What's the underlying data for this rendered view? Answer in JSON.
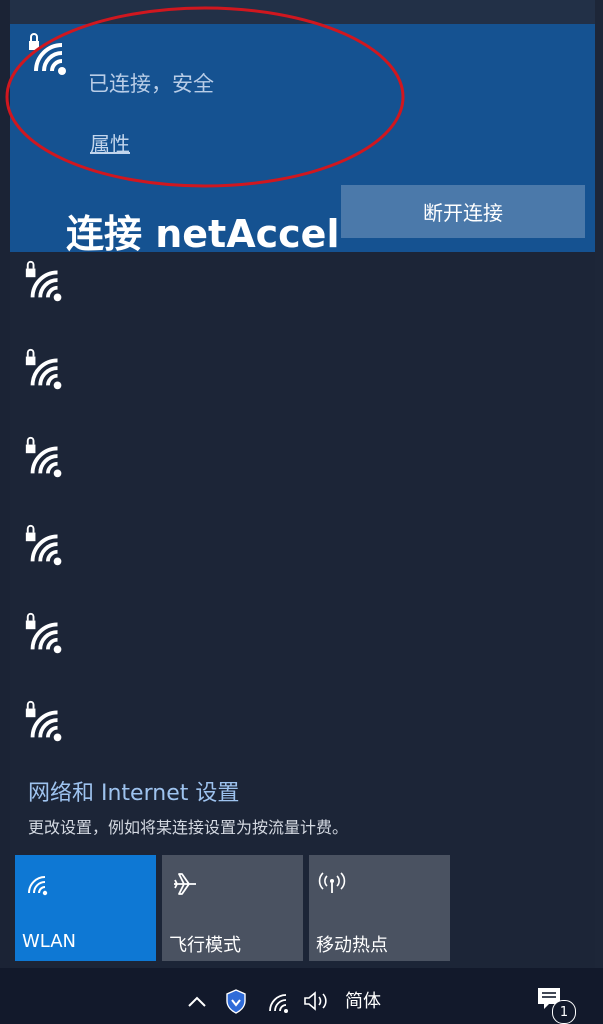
{
  "connected_network": {
    "status": "已连接，安全",
    "properties_link": "属性",
    "disconnect_button": "断开连接"
  },
  "overlay_title": "连接 netAccel",
  "network_list": {
    "items": [
      {
        "icon": "wifi-secured-icon"
      },
      {
        "icon": "wifi-secured-icon"
      },
      {
        "icon": "wifi-secured-icon"
      },
      {
        "icon": "wifi-secured-icon"
      },
      {
        "icon": "wifi-secured-icon"
      },
      {
        "icon": "wifi-secured-icon"
      }
    ]
  },
  "settings": {
    "title": "网络和 Internet 设置",
    "subtitle": "更改设置，例如将某连接设置为按流量计费。"
  },
  "quick_actions": [
    {
      "label": "WLAN",
      "icon": "wifi-icon",
      "active": true
    },
    {
      "label": "飞行模式",
      "icon": "airplane-icon",
      "active": false
    },
    {
      "label": "移动热点",
      "icon": "hotspot-icon",
      "active": false
    }
  ],
  "taskbar": {
    "language": "简体",
    "notification_count": "1"
  },
  "colors": {
    "accent": "#0e78d4",
    "annotation": "#d0171f",
    "connected_bg": "#155291"
  }
}
